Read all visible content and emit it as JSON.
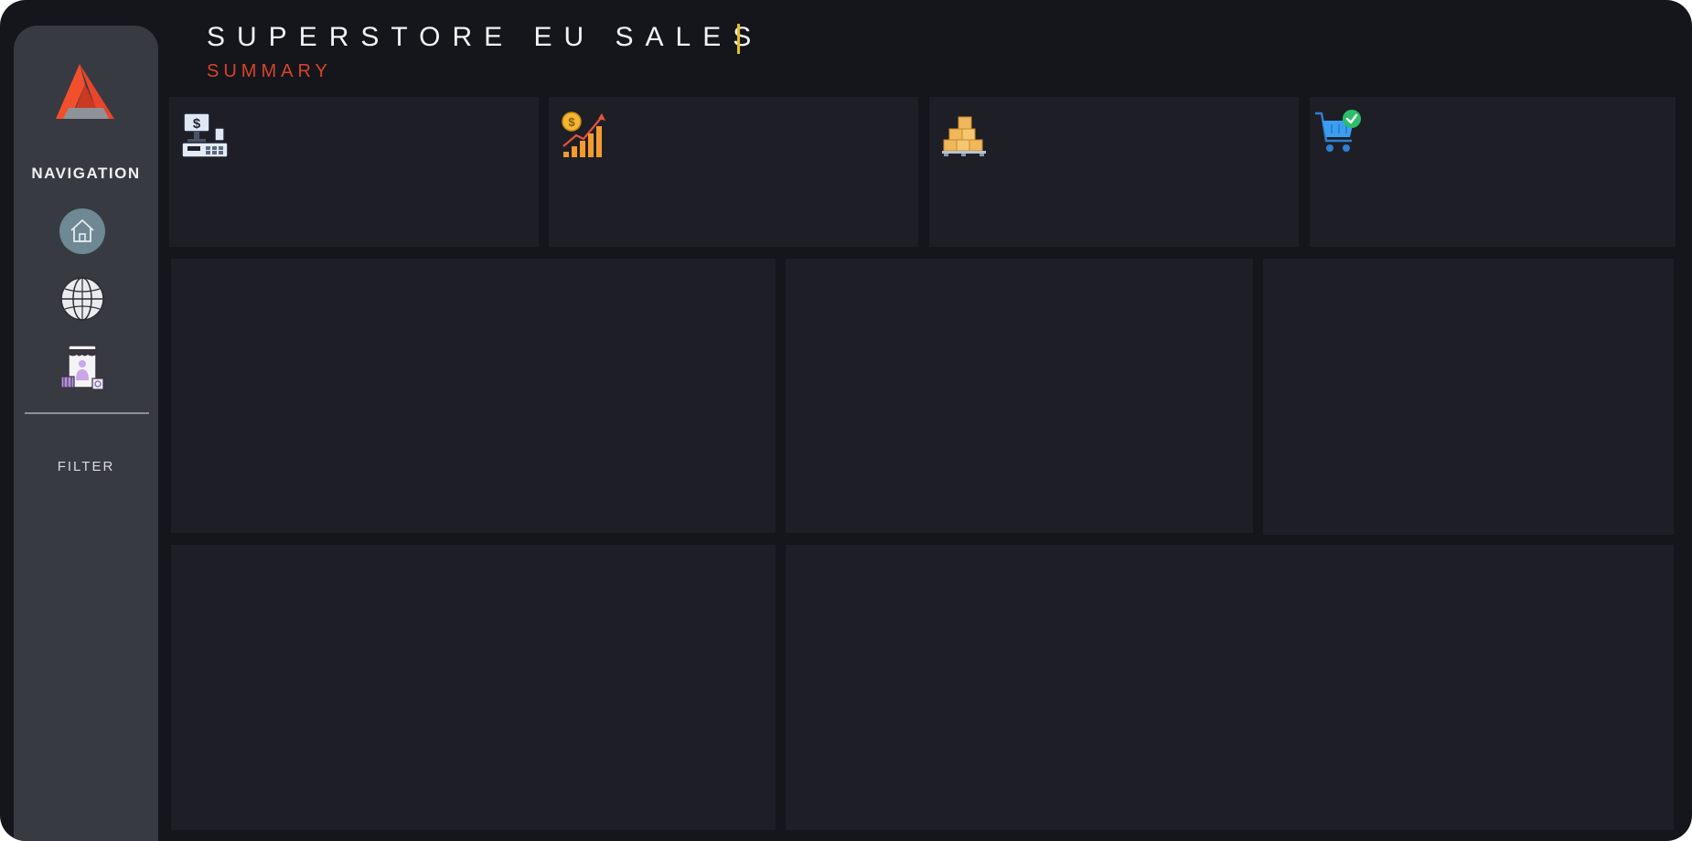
{
  "header": {
    "title": "SUPERSTORE EU SALES",
    "subtitle": "SUMMARY"
  },
  "sidebar": {
    "logo": "brand-logo",
    "navigation_label": "NAVIGATION",
    "nav_items": [
      {
        "icon": "home-icon"
      },
      {
        "icon": "globe-icon"
      },
      {
        "icon": "store-icon"
      }
    ],
    "filter_label": "FILTER"
  },
  "kpi_cards": [
    {
      "icon": "cash-register-icon"
    },
    {
      "icon": "growth-chart-icon"
    },
    {
      "icon": "boxes-pallet-icon"
    },
    {
      "icon": "shopping-cart-check-icon"
    }
  ],
  "colors": {
    "background": "#15161b",
    "sidebar": "#383a41",
    "panel": "#1e1f26",
    "accent": "#d8432b",
    "cursor": "#e6c021",
    "home_button": "#6e8894"
  }
}
